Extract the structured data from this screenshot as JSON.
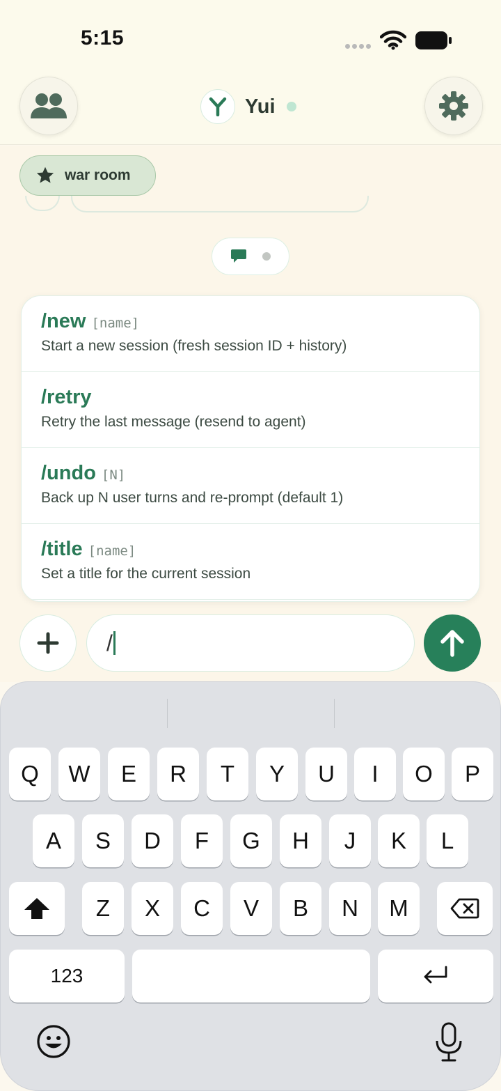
{
  "status_bar": {
    "time": "5:15"
  },
  "header": {
    "title": "Yui"
  },
  "room_chip": {
    "label": "war room"
  },
  "commands": [
    {
      "name": "/new",
      "arg": "[name]",
      "description": "Start a new session (fresh session ID + history)"
    },
    {
      "name": "/retry",
      "arg": "",
      "description": "Retry the last message (resend to agent)"
    },
    {
      "name": "/undo",
      "arg": "[N]",
      "description": "Back up N user turns and re-prompt (default 1)"
    },
    {
      "name": "/title",
      "arg": "[name]",
      "description": "Set a title for the current session"
    }
  ],
  "composer": {
    "value": "/"
  },
  "keyboard": {
    "row1": [
      "Q",
      "W",
      "E",
      "R",
      "T",
      "Y",
      "U",
      "I",
      "O",
      "P"
    ],
    "row2": [
      "A",
      "S",
      "D",
      "F",
      "G",
      "H",
      "J",
      "K",
      "L"
    ],
    "row3": [
      "Z",
      "X",
      "C",
      "V",
      "B",
      "N",
      "M"
    ],
    "numbers_key": "123"
  },
  "colors": {
    "accent": "#27805a",
    "chip_bg": "#d9e7d4",
    "background": "#fcf6e9"
  }
}
